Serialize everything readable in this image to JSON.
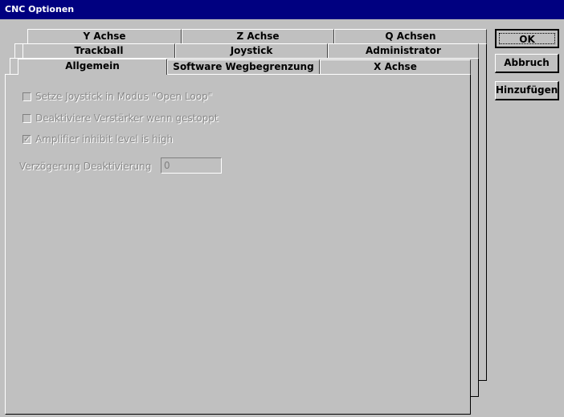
{
  "window": {
    "title": "CNC Optionen"
  },
  "tabs_row1": [
    {
      "label": "Y Achse"
    },
    {
      "label": "Z Achse"
    },
    {
      "label": "Q Achsen"
    }
  ],
  "tabs_row2": [
    {
      "label": "Trackball"
    },
    {
      "label": "Joystick"
    },
    {
      "label": "Administrator"
    }
  ],
  "tabs_row3": [
    {
      "label": "Allgemein",
      "active": true
    },
    {
      "label": "Software Wegbegrenzung"
    },
    {
      "label": "X Achse"
    }
  ],
  "options": [
    {
      "label": "Setze Joystick in Modus \"Open Loop\"",
      "checked": false,
      "enabled": false
    },
    {
      "label": "Deaktiviere Verstärker wenn gestoppt",
      "checked": false,
      "enabled": false
    },
    {
      "label": "Amplifier inhibit level is high",
      "checked": true,
      "enabled": false
    }
  ],
  "delay": {
    "label": "Verzögerung Deaktivierung",
    "value": "0"
  },
  "buttons": {
    "ok": "OK",
    "cancel": "Abbruch",
    "add": "Hinzufügen"
  }
}
